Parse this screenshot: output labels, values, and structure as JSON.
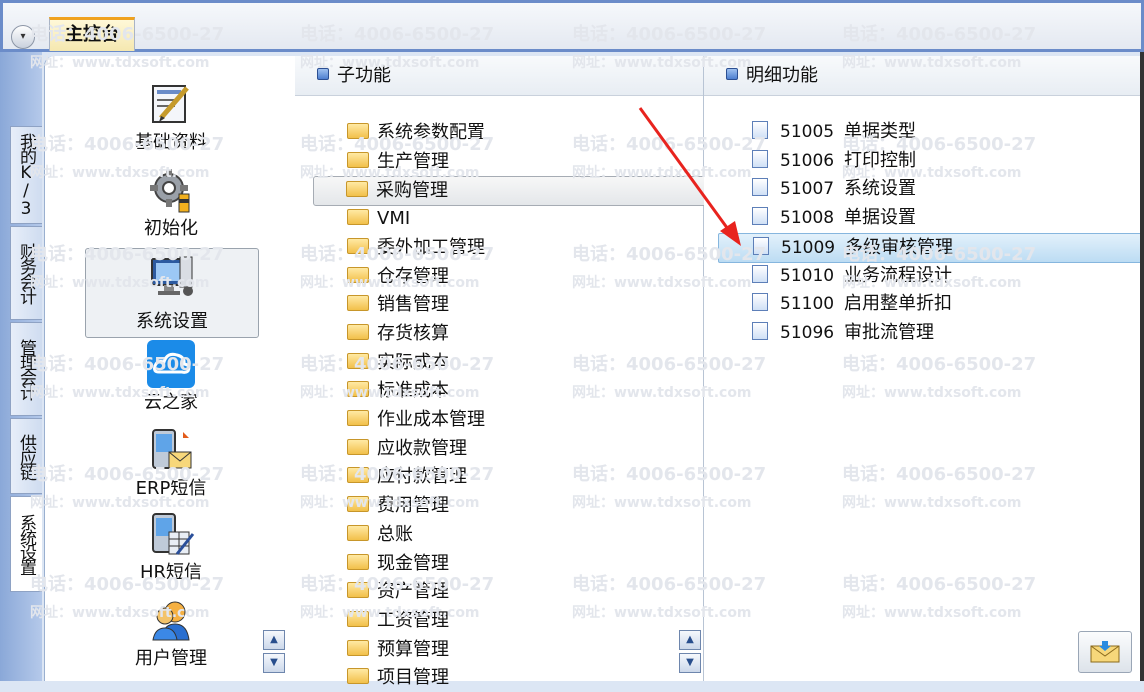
{
  "topbar": {
    "menu_glyph": "▾",
    "tab_label": "主控台"
  },
  "vertical_tabs": [
    {
      "label": "我的K/3"
    },
    {
      "label": "财务会计"
    },
    {
      "label": "管理会计"
    },
    {
      "label": "供应链"
    },
    {
      "label": "系统设置"
    }
  ],
  "modules": [
    {
      "label": "基础资料",
      "icon": "document-pen-icon"
    },
    {
      "label": "初始化",
      "icon": "gear-icon"
    },
    {
      "label": "系统设置",
      "icon": "computer-settings-icon"
    },
    {
      "label": "云之家",
      "icon": "cloud-icon"
    },
    {
      "label": "ERP短信",
      "icon": "phone-mail-icon"
    },
    {
      "label": "HR短信",
      "icon": "phone-calc-icon"
    },
    {
      "label": "用户管理",
      "icon": "users-icon"
    }
  ],
  "sub_functions": {
    "header": "子功能",
    "items": [
      "系统参数配置",
      "生产管理",
      "采购管理",
      "VMI",
      "委外加工管理",
      "仓存管理",
      "销售管理",
      "存货核算",
      "实际成本",
      "标准成本",
      "作业成本管理",
      "应收款管理",
      "应付款管理",
      "费用管理",
      "总账",
      "现金管理",
      "资产管理",
      "工资管理",
      "预算管理",
      "项目管理"
    ],
    "selected": "采购管理"
  },
  "detail_functions": {
    "header": "明细功能",
    "items": [
      {
        "code": "51005",
        "name": "单据类型"
      },
      {
        "code": "51006",
        "name": "打印控制"
      },
      {
        "code": "51007",
        "name": "系统设置"
      },
      {
        "code": "51008",
        "name": "单据设置"
      },
      {
        "code": "51009",
        "name": "多级审核管理"
      },
      {
        "code": "51010",
        "name": "业务流程设计"
      },
      {
        "code": "51100",
        "name": "启用整单折扣"
      },
      {
        "code": "51096",
        "name": "审批流管理"
      }
    ],
    "highlighted": "51009"
  },
  "watermark": {
    "phone": "电话：4006-6500-27",
    "site": "网址：www.tdxsoft.com"
  },
  "colors": {
    "accent_tab": "#f0a21f",
    "highlight": "#bcdcf3",
    "arrow": "#e8231e"
  }
}
